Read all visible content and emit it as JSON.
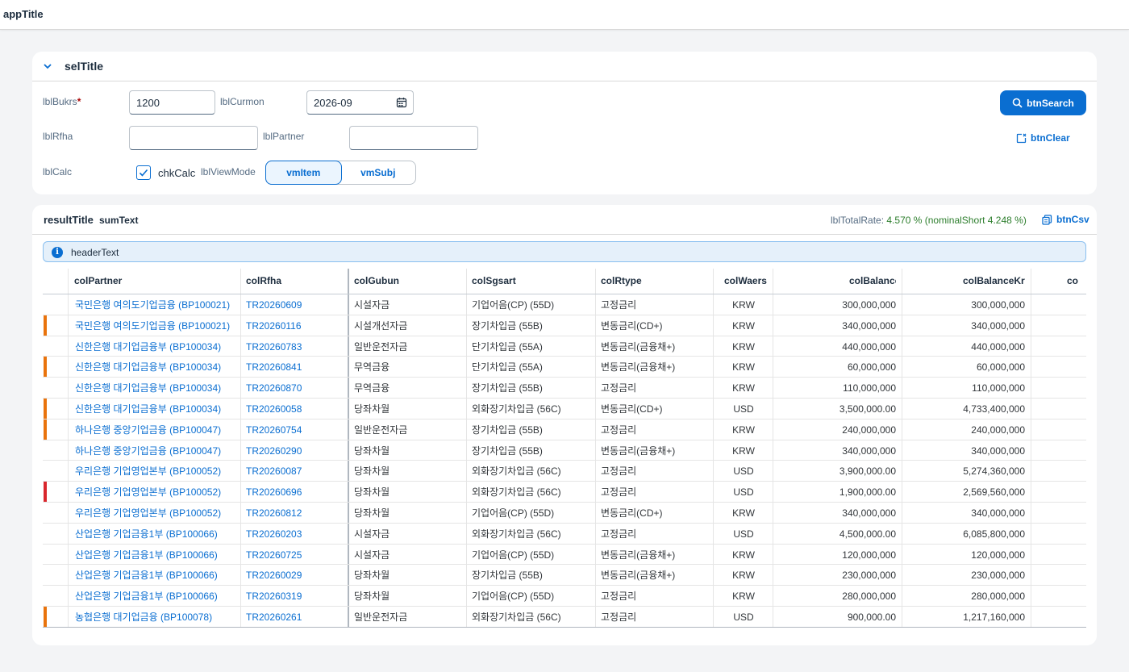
{
  "app": {
    "title": "appTitle"
  },
  "selection": {
    "title": "selTitle",
    "lblBukrs": "lblBukrs",
    "bukrs_value": "1200",
    "lblCurmon": "lblCurmon",
    "curmon_value": "2026-09",
    "lblRfha": "lblRfha",
    "rfha_value": "",
    "lblPartner": "lblPartner",
    "partner_value": "",
    "lblCalc": "lblCalc",
    "chkCalc": "chkCalc",
    "chkCalc_checked": true,
    "lblViewMode": "lblViewMode",
    "vmItem": "vmItem",
    "vmSubj": "vmSubj",
    "btnSearch": "btnSearch",
    "btnClear": "btnClear"
  },
  "result": {
    "title": "resultTitle",
    "sumText": "sumText",
    "lblTotalRate": "lblTotalRate:",
    "rateValue": "4.570 % (nominalShort 4.248 %)",
    "btnCsv": "btnCsv",
    "headerText": "headerText",
    "columns": [
      "colPartner",
      "colRfha",
      "colGubun",
      "colSgsart",
      "colRtype",
      "colWaers",
      "colBalance",
      "colBalanceKrw",
      "co"
    ],
    "colors": {
      "orange": "#e9730c",
      "red": "#d9262c",
      "link": "#0a6ed1",
      "rate_green": "#2b7d2b"
    },
    "rows": [
      {
        "indicator": "",
        "partner": "국민은행 여의도기업금융 (BP100021)",
        "rfha": "TR20260609",
        "gubun": "시설자금",
        "sgsart": "기업어음(CP) (55D)",
        "rtype": "고정금리",
        "waers": "KRW",
        "balance": "300,000,000",
        "balanceKrw": "300,000,000"
      },
      {
        "indicator": "orange",
        "partner": "국민은행 여의도기업금융 (BP100021)",
        "rfha": "TR20260116",
        "gubun": "시설개선자금",
        "sgsart": "장기차입금 (55B)",
        "rtype": "변동금리(CD+)",
        "waers": "KRW",
        "balance": "340,000,000",
        "balanceKrw": "340,000,000"
      },
      {
        "indicator": "",
        "partner": "신한은행 대기업금융부 (BP100034)",
        "rfha": "TR20260783",
        "gubun": "일반운전자금",
        "sgsart": "단기차입금 (55A)",
        "rtype": "변동금리(금융채+)",
        "waers": "KRW",
        "balance": "440,000,000",
        "balanceKrw": "440,000,000"
      },
      {
        "indicator": "orange",
        "partner": "신한은행 대기업금융부 (BP100034)",
        "rfha": "TR20260841",
        "gubun": "무역금융",
        "sgsart": "단기차입금 (55A)",
        "rtype": "변동금리(금융채+)",
        "waers": "KRW",
        "balance": "60,000,000",
        "balanceKrw": "60,000,000"
      },
      {
        "indicator": "",
        "partner": "신한은행 대기업금융부 (BP100034)",
        "rfha": "TR20260870",
        "gubun": "무역금융",
        "sgsart": "장기차입금 (55B)",
        "rtype": "고정금리",
        "waers": "KRW",
        "balance": "110,000,000",
        "balanceKrw": "110,000,000"
      },
      {
        "indicator": "orange",
        "partner": "신한은행 대기업금융부 (BP100034)",
        "rfha": "TR20260058",
        "gubun": "당좌차월",
        "sgsart": "외화장기차입금 (56C)",
        "rtype": "변동금리(CD+)",
        "waers": "USD",
        "balance": "3,500,000.00",
        "balanceKrw": "4,733,400,000"
      },
      {
        "indicator": "orange",
        "partner": "하나은행 중앙기업금융 (BP100047)",
        "rfha": "TR20260754",
        "gubun": "일반운전자금",
        "sgsart": "장기차입금 (55B)",
        "rtype": "고정금리",
        "waers": "KRW",
        "balance": "240,000,000",
        "balanceKrw": "240,000,000"
      },
      {
        "indicator": "",
        "partner": "하나은행 중앙기업금융 (BP100047)",
        "rfha": "TR20260290",
        "gubun": "당좌차월",
        "sgsart": "장기차입금 (55B)",
        "rtype": "변동금리(금융채+)",
        "waers": "KRW",
        "balance": "340,000,000",
        "balanceKrw": "340,000,000"
      },
      {
        "indicator": "",
        "partner": "우리은행 기업영업본부 (BP100052)",
        "rfha": "TR20260087",
        "gubun": "당좌차월",
        "sgsart": "외화장기차입금 (56C)",
        "rtype": "고정금리",
        "waers": "USD",
        "balance": "3,900,000.00",
        "balanceKrw": "5,274,360,000"
      },
      {
        "indicator": "red",
        "partner": "우리은행 기업영업본부 (BP100052)",
        "rfha": "TR20260696",
        "gubun": "당좌차월",
        "sgsart": "외화장기차입금 (56C)",
        "rtype": "고정금리",
        "waers": "USD",
        "balance": "1,900,000.00",
        "balanceKrw": "2,569,560,000"
      },
      {
        "indicator": "",
        "partner": "우리은행 기업영업본부 (BP100052)",
        "rfha": "TR20260812",
        "gubun": "당좌차월",
        "sgsart": "기업어음(CP) (55D)",
        "rtype": "변동금리(CD+)",
        "waers": "KRW",
        "balance": "340,000,000",
        "balanceKrw": "340,000,000"
      },
      {
        "indicator": "",
        "partner": "산업은행 기업금융1부 (BP100066)",
        "rfha": "TR20260203",
        "gubun": "시설자금",
        "sgsart": "외화장기차입금 (56C)",
        "rtype": "고정금리",
        "waers": "USD",
        "balance": "4,500,000.00",
        "balanceKrw": "6,085,800,000"
      },
      {
        "indicator": "",
        "partner": "산업은행 기업금융1부 (BP100066)",
        "rfha": "TR20260725",
        "gubun": "시설자금",
        "sgsart": "기업어음(CP) (55D)",
        "rtype": "변동금리(금융채+)",
        "waers": "KRW",
        "balance": "120,000,000",
        "balanceKrw": "120,000,000"
      },
      {
        "indicator": "",
        "partner": "산업은행 기업금융1부 (BP100066)",
        "rfha": "TR20260029",
        "gubun": "당좌차월",
        "sgsart": "장기차입금 (55B)",
        "rtype": "변동금리(금융채+)",
        "waers": "KRW",
        "balance": "230,000,000",
        "balanceKrw": "230,000,000"
      },
      {
        "indicator": "",
        "partner": "산업은행 기업금융1부 (BP100066)",
        "rfha": "TR20260319",
        "gubun": "당좌차월",
        "sgsart": "기업어음(CP) (55D)",
        "rtype": "고정금리",
        "waers": "KRW",
        "balance": "280,000,000",
        "balanceKrw": "280,000,000"
      },
      {
        "indicator": "orange",
        "partner": "농협은행 대기업금융 (BP100078)",
        "rfha": "TR20260261",
        "gubun": "일반운전자금",
        "sgsart": "외화장기차입금 (56C)",
        "rtype": "고정금리",
        "waers": "USD",
        "balance": "900,000.00",
        "balanceKrw": "1,217,160,000"
      }
    ]
  }
}
